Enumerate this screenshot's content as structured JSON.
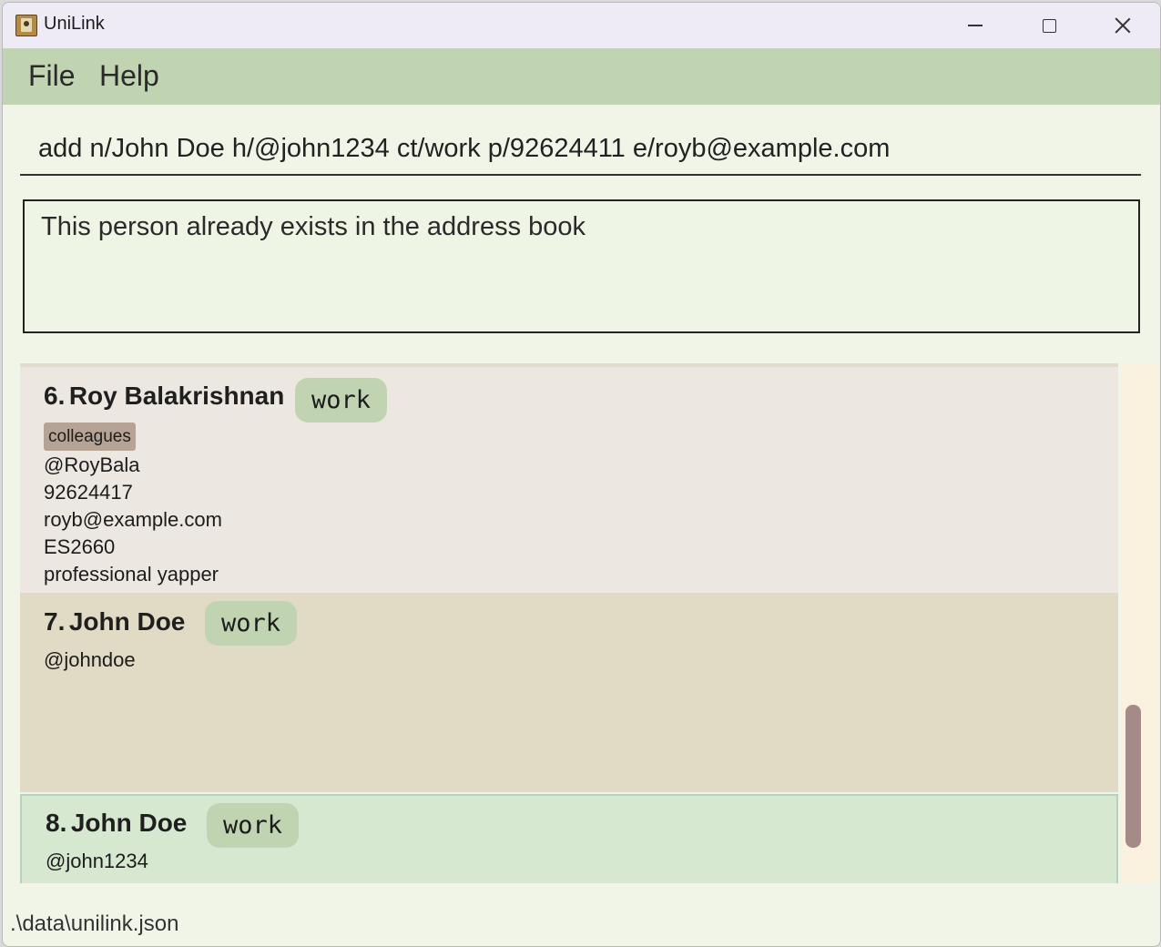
{
  "window": {
    "title": "UniLink"
  },
  "menu": {
    "file": "File",
    "help": "Help"
  },
  "command": {
    "value": "add n/John Doe h/@john1234 ct/work p/92624411 e/royb@example.com"
  },
  "result": {
    "message": "This person already exists in the address book"
  },
  "contacts": [
    {
      "index": "6.",
      "name": "Roy Balakrishnan",
      "type": "work",
      "tag": "colleagues",
      "handle": "@RoyBala",
      "phone": "92624417",
      "email": "royb@example.com",
      "module": "ES2660",
      "remark": "professional yapper"
    },
    {
      "index": "7.",
      "name": "John Doe",
      "type": "work",
      "handle": "@johndoe"
    },
    {
      "index": "8.",
      "name": "John Doe",
      "type": "work",
      "handle": "@john1234"
    }
  ],
  "status": {
    "path": ".\\data\\unilink.json"
  },
  "colors": {
    "menubar": "#c1d4b2",
    "card_default": "#ece8e1",
    "card_alt": "#e1dac5",
    "card_selected": "#d7e8d0",
    "type_pill": "#c1d4b2",
    "tag_pill": "#b5a495",
    "scroll_thumb": "#a48b88"
  }
}
